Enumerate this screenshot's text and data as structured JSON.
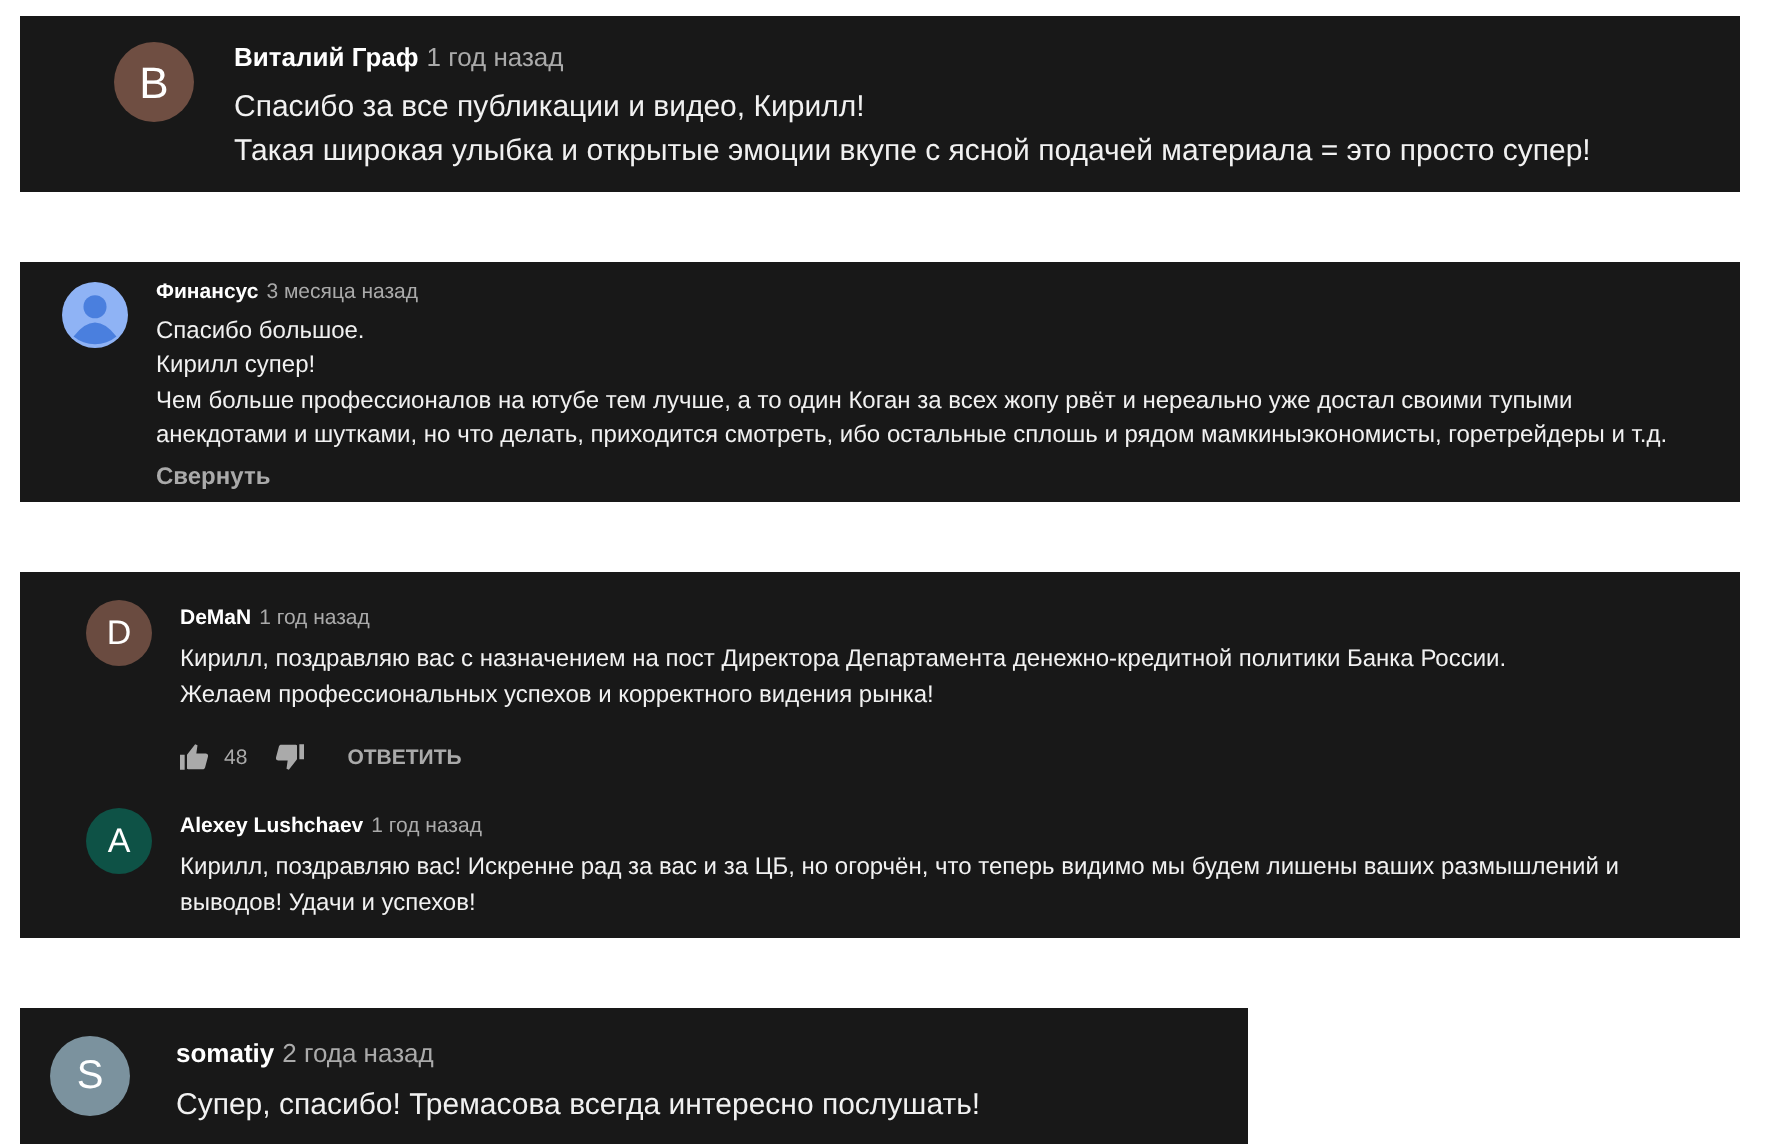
{
  "panels": [
    {
      "comments": [
        {
          "author": "Виталий Граф",
          "time": "1 год назад",
          "avatar": {
            "kind": "letter",
            "letter": "В",
            "color": "#6f4e42"
          },
          "lines": [
            "Спасибо за все публикации и видео, Кирилл!",
            "Такая широкая улыбка и открытые эмоции вкупе с ясной подачей материала = это просто супер!"
          ]
        }
      ]
    },
    {
      "comments": [
        {
          "author": "Финансус",
          "time": "3 месяца назад",
          "avatar": {
            "kind": "silhouette",
            "color": "#8fb3f5"
          },
          "lines": [
            "Спасибо большое.",
            "Кирилл супер!",
            "Чем больше профессионалов на ютубе тем лучше, а то один Коган за всех жопу рвёт и нереально уже достал своими тупыми анекдотами и шутками, но что делать, приходится смотреть, ибо остальные сплошь и рядом мамкиныэкономисты, горетрейдеры и т.д."
          ],
          "collapse": "Свернуть"
        }
      ]
    },
    {
      "comments": [
        {
          "author": "DeMaN",
          "time": "1 год назад",
          "avatar": {
            "kind": "letter",
            "letter": "D",
            "color": "#6a4b40"
          },
          "lines": [
            "Кирилл, поздравляю вас с назначением на пост Директора Департамента денежно-кредитной политики Банка России.",
            "Желаем профессиональных успехов и корректного  видения рынка!"
          ],
          "likes": "48",
          "reply": "ОТВЕТИТЬ"
        },
        {
          "author": "Alexey Lushchaev",
          "time": "1 год назад",
          "avatar": {
            "kind": "letter",
            "letter": "A",
            "color": "#0e5246"
          },
          "lines": [
            "Кирилл, поздравляю вас! Искренне рад за вас и за ЦБ, но огорчён, что теперь видимо мы будем лишены ваших размышлений и выводов! Удачи и успехов!"
          ]
        }
      ]
    },
    {
      "comments": [
        {
          "author": "somatiy",
          "time": "2 года назад",
          "avatar": {
            "kind": "letter",
            "letter": "S",
            "color": "#7b929e"
          },
          "lines": [
            "Супер, спасибо! Тремасова всегда интересно послушать!"
          ]
        }
      ]
    }
  ]
}
